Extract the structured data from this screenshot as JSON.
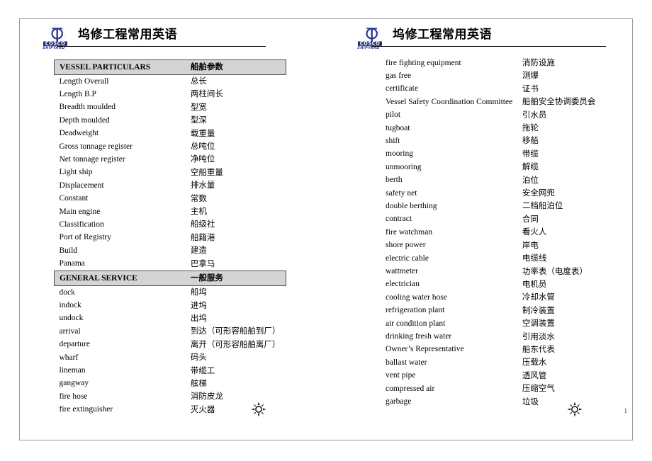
{
  "document": {
    "title": "坞修工程常用英语",
    "page_number": "1",
    "logo": {
      "brand": "COSCO",
      "sub_brand": "SHIPYARD",
      "brand_color": "#1f2d7a",
      "mark_color": "#2b3a8f"
    },
    "ornament_icon": "sun-burst-ornament"
  },
  "slides": [
    {
      "id": "slide-left",
      "rows": [
        {
          "type": "section",
          "en": "VESSEL PARTICULARS",
          "zh": "船舶参数"
        },
        {
          "type": "entry",
          "en": "Length Overall",
          "zh": "总长"
        },
        {
          "type": "entry",
          "en": "Length B.P",
          "zh": "两柱间长"
        },
        {
          "type": "entry",
          "en": "Breadth moulded",
          "zh": "型宽"
        },
        {
          "type": "entry",
          "en": "Depth moulded",
          "zh": "型深"
        },
        {
          "type": "entry",
          "en": "Deadweight",
          "zh": "载重量"
        },
        {
          "type": "entry",
          "en": "Gross tonnage register",
          "zh": "总吨位"
        },
        {
          "type": "entry",
          "en": "Net tonnage register",
          "zh": "净吨位"
        },
        {
          "type": "entry",
          "en": "Light ship",
          "zh": "空船重量"
        },
        {
          "type": "entry",
          "en": "Displacement",
          "zh": "排水量"
        },
        {
          "type": "entry",
          "en": "Constant",
          "zh": "常数"
        },
        {
          "type": "entry",
          "en": "Main engine",
          "zh": "主机"
        },
        {
          "type": "entry",
          "en": "Classification",
          "zh": "船级社"
        },
        {
          "type": "entry",
          "en": "Port of Registry",
          "zh": "船籍港"
        },
        {
          "type": "entry",
          "en": "Build",
          "zh": "建造"
        },
        {
          "type": "entry",
          "en": "Panama",
          "zh": "巴拿马"
        },
        {
          "type": "section",
          "en": "GENERAL SERVICE",
          "zh": "一般服务"
        },
        {
          "type": "entry",
          "en": "dock",
          "zh": "船坞"
        },
        {
          "type": "entry",
          "en": "indock",
          "zh": "进坞"
        },
        {
          "type": "entry",
          "en": "undock",
          "zh": "出坞"
        },
        {
          "type": "entry",
          "en": "arrival",
          "zh": "到达（可形容船舶到厂）"
        },
        {
          "type": "entry",
          "en": "departure",
          "zh": "离开（可形容船舶离厂）"
        },
        {
          "type": "entry",
          "en": "wharf",
          "zh": "码头"
        },
        {
          "type": "entry",
          "en": "lineman",
          "zh": "带缆工"
        },
        {
          "type": "entry",
          "en": "gangway",
          "zh": "舷梯"
        },
        {
          "type": "entry",
          "en": "fire hose",
          "zh": "消防皮龙"
        },
        {
          "type": "entry",
          "en": "fire extinguisher",
          "zh": "灭火器"
        }
      ]
    },
    {
      "id": "slide-right",
      "rows": [
        {
          "type": "entry",
          "en": "fire fighting equipment",
          "zh": "消防设施"
        },
        {
          "type": "entry",
          "en": "gas free",
          "zh": "测爆"
        },
        {
          "type": "entry",
          "en": "certificate",
          "zh": "证书"
        },
        {
          "type": "entry",
          "en": "Vessel Safety Coordination Committee",
          "zh": "船舶安全协调委员会"
        },
        {
          "type": "entry",
          "en": "pilot",
          "zh": "引水员"
        },
        {
          "type": "entry",
          "en": "tugboat",
          "zh": "拖轮"
        },
        {
          "type": "entry",
          "en": "shift",
          "zh": "移船"
        },
        {
          "type": "entry",
          "en": "mooring",
          "zh": "带缆"
        },
        {
          "type": "entry",
          "en": "unmooring",
          "zh": "解缆"
        },
        {
          "type": "entry",
          "en": "berth",
          "zh": "泊位"
        },
        {
          "type": "entry",
          "en": "safety net",
          "zh": "安全网兜"
        },
        {
          "type": "entry",
          "en": "double berthing",
          "zh": "二档船泊位"
        },
        {
          "type": "entry",
          "en": "contract",
          "zh": "合同"
        },
        {
          "type": "entry",
          "en": "fire watchman",
          "zh": "看火人"
        },
        {
          "type": "entry",
          "en": "shore power",
          "zh": "岸电"
        },
        {
          "type": "entry",
          "en": "electric cable",
          "zh": "电缆线"
        },
        {
          "type": "entry",
          "en": "wattmeter",
          "zh": "功率表（电度表）"
        },
        {
          "type": "entry",
          "en": "electrician",
          "zh": "电机员"
        },
        {
          "type": "entry",
          "en": "cooling water hose",
          "zh": "冷却水管"
        },
        {
          "type": "entry",
          "en": "refrigeration plant",
          "zh": "制冷装置"
        },
        {
          "type": "entry",
          "en": "air condition plant",
          "zh": "空调装置"
        },
        {
          "type": "entry",
          "en": "drinking fresh water",
          "zh": "引用淡水"
        },
        {
          "type": "entry",
          "en": "Owner’s Representative",
          "zh": "船东代表"
        },
        {
          "type": "entry",
          "en": "ballast water",
          "zh": "压载水"
        },
        {
          "type": "entry",
          "en": "vent pipe",
          "zh": "透风管"
        },
        {
          "type": "entry",
          "en": "compressed air",
          "zh": "压缩空气"
        },
        {
          "type": "entry",
          "en": "garbage",
          "zh": "垃圾"
        }
      ]
    }
  ]
}
